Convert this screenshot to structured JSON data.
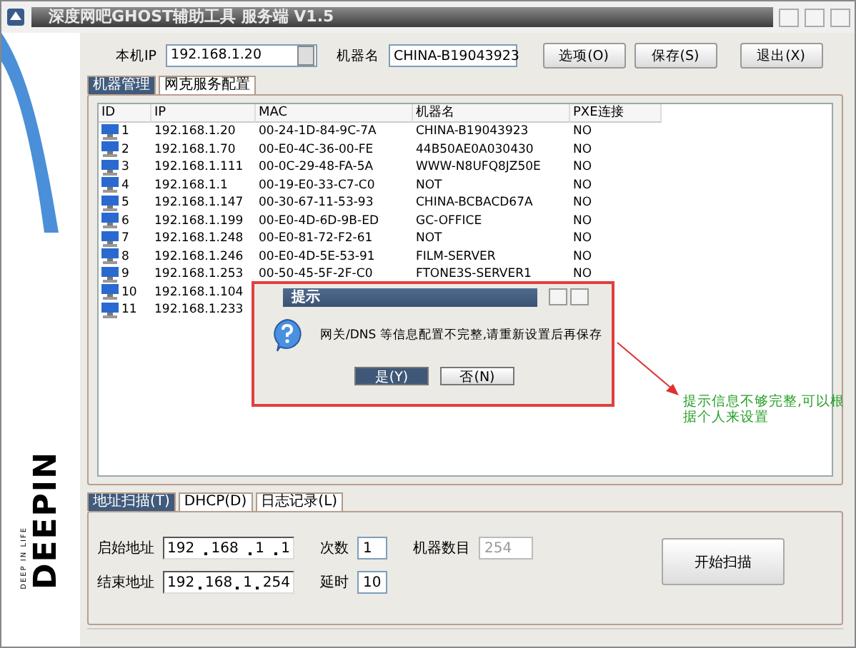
{
  "window": {
    "title": "深度网吧GHOST辅助工具 服务端 V1.5"
  },
  "branding": {
    "logo": "DEEPIN",
    "tagline": "DEEP IN LIFE"
  },
  "toolbar": {
    "local_ip_label": "本机IP",
    "local_ip": "192.168.1.20",
    "machine_name_label": "机器名",
    "machine_name": "CHINA-B19043923",
    "buttons": [
      "选项(O)",
      "保存(S)",
      "退出(X)"
    ]
  },
  "tabs": [
    {
      "label": "机器管理",
      "selected": true
    },
    {
      "label": "网克服务配置",
      "selected": false
    }
  ],
  "table": {
    "columns": [
      "ID",
      "IP",
      "MAC",
      "机器名",
      "PXE连接"
    ],
    "rows": [
      {
        "id": "1",
        "ip": "192.168.1.20",
        "mac": "00-24-1D-84-9C-7A",
        "name": "CHINA-B19043923",
        "pxe": "NO"
      },
      {
        "id": "2",
        "ip": "192.168.1.70",
        "mac": "00-E0-4C-36-00-FE",
        "name": "44B50AE0A030430",
        "pxe": "NO"
      },
      {
        "id": "3",
        "ip": "192.168.1.111",
        "mac": "00-0C-29-48-FA-5A",
        "name": "WWW-N8UFQ8JZ50E",
        "pxe": "NO"
      },
      {
        "id": "4",
        "ip": "192.168.1.1",
        "mac": "00-19-E0-33-C7-C0",
        "name": "NOT",
        "pxe": "NO"
      },
      {
        "id": "5",
        "ip": "192.168.1.147",
        "mac": "00-30-67-11-53-93",
        "name": "CHINA-BCBACD67A",
        "pxe": "NO"
      },
      {
        "id": "6",
        "ip": "192.168.1.199",
        "mac": "00-E0-4D-6D-9B-ED",
        "name": "GC-OFFICE",
        "pxe": "NO"
      },
      {
        "id": "7",
        "ip": "192.168.1.248",
        "mac": "00-E0-81-72-F2-61",
        "name": "NOT",
        "pxe": "NO"
      },
      {
        "id": "8",
        "ip": "192.168.1.246",
        "mac": "00-E0-4D-5E-53-91",
        "name": "FILM-SERVER",
        "pxe": "NO"
      },
      {
        "id": "9",
        "ip": "192.168.1.253",
        "mac": "00-50-45-5F-2F-C0",
        "name": "FTONE3S-SERVER1",
        "pxe": "NO"
      },
      {
        "id": "10",
        "ip": "192.168.1.104"
      },
      {
        "id": "11",
        "ip": "192.168.1.233"
      }
    ]
  },
  "bottom_tabs": [
    {
      "label": "地址扫描(T)",
      "selected": true
    },
    {
      "label": "DHCP(D)",
      "selected": false
    },
    {
      "label": "日志记录(L)",
      "selected": false
    }
  ],
  "scan": {
    "start_label": "启始地址",
    "start_ip": [
      "192",
      "168",
      "1",
      "1"
    ],
    "count_label": "次数",
    "count": "1",
    "machines_label": "机器数目",
    "machines": "254",
    "machines_disabled": true,
    "end_label": "结束地址",
    "end_ip": [
      "192",
      "168",
      "1",
      "254"
    ],
    "delay_label": "延时",
    "delay": "10",
    "scan_button": "开始扫描"
  },
  "dialog": {
    "title": "提示",
    "message": "网关/DNS 等信息配置不完整,请重新设置后再保存",
    "buttons": [
      {
        "label": "是(Y)",
        "selected": true
      },
      {
        "label": "否(N)",
        "selected": false
      }
    ]
  },
  "annotation": {
    "text": "提示信息不够完整,可以根据个人来设置"
  }
}
